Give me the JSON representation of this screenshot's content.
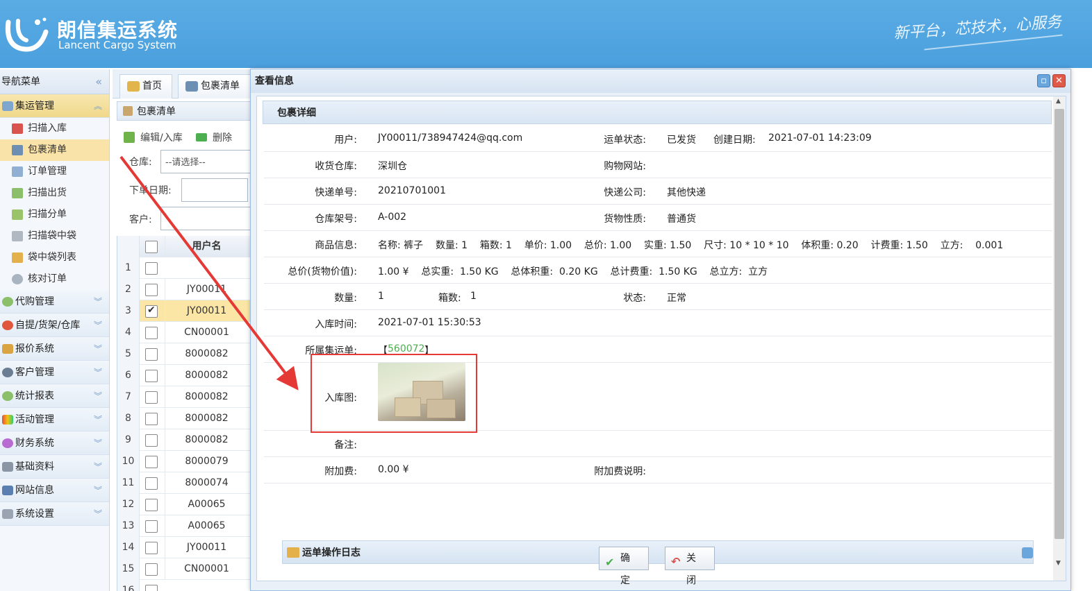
{
  "header": {
    "app_title": "朗信集运系统",
    "app_subtitle": "Lancent Cargo System",
    "slogan": "新平台，芯技术，心服务"
  },
  "sidebar": {
    "title": "导航菜单",
    "collapse_glyph": "«",
    "groups": [
      {
        "label": "集运管理",
        "open": true
      },
      {
        "label": "代购管理"
      },
      {
        "label": "自提/货架/仓库"
      },
      {
        "label": "报价系统"
      },
      {
        "label": "客户管理"
      },
      {
        "label": "统计报表"
      },
      {
        "label": "活动管理"
      },
      {
        "label": "财务系统"
      },
      {
        "label": "基础资料"
      },
      {
        "label": "网站信息"
      },
      {
        "label": "系统设置"
      }
    ],
    "items": [
      {
        "label": "扫描入库"
      },
      {
        "label": "包裹清单",
        "active": true
      },
      {
        "label": "订单管理"
      },
      {
        "label": "扫描出货"
      },
      {
        "label": "扫描分单"
      },
      {
        "label": "扫描袋中袋"
      },
      {
        "label": "袋中袋列表"
      },
      {
        "label": "核对订单"
      }
    ]
  },
  "tabs": [
    {
      "label": "首页"
    },
    {
      "label": "包裹清单"
    }
  ],
  "list_panel": {
    "title": "包裹清单",
    "toolbar": {
      "edit_label": "编辑/入库",
      "delete_label": "删除"
    },
    "filters": {
      "warehouse_label": "仓库:",
      "warehouse_value": "--请选择--",
      "order_date_label": "下单日期:",
      "customer_label": "客户:"
    },
    "grid": {
      "column_username": "用户名",
      "rows": [
        {
          "n": "1",
          "user": ""
        },
        {
          "n": "2",
          "user": "JY00011"
        },
        {
          "n": "3",
          "user": "JY00011",
          "selected": true
        },
        {
          "n": "4",
          "user": "CN00001"
        },
        {
          "n": "5",
          "user": "8000082"
        },
        {
          "n": "6",
          "user": "8000082"
        },
        {
          "n": "7",
          "user": "8000082"
        },
        {
          "n": "8",
          "user": "8000082"
        },
        {
          "n": "9",
          "user": "8000082"
        },
        {
          "n": "10",
          "user": "8000079"
        },
        {
          "n": "11",
          "user": "8000074"
        },
        {
          "n": "12",
          "user": "A00065"
        },
        {
          "n": "13",
          "user": "A00065"
        },
        {
          "n": "14",
          "user": "JY00011"
        },
        {
          "n": "15",
          "user": "CN00001"
        },
        {
          "n": "16",
          "user": ""
        }
      ]
    }
  },
  "dialog": {
    "title": "查看信息",
    "section_title": "包裹详细",
    "fields": {
      "user_label": "用户:",
      "user_value": "JY00011/738947424@qq.com",
      "status_label": "运单状态:",
      "status_value": "已发货",
      "created_label": "创建日期:",
      "created_value": "2021-07-01 14:23:09",
      "warehouse_label": "收货仓库:",
      "warehouse_value": "深圳仓",
      "site_label": "购物网站:",
      "tracking_label": "快递单号:",
      "tracking_value": "20210701001",
      "courier_label": "快递公司:",
      "courier_value": "其他快递",
      "shelf_label": "仓库架号:",
      "shelf_value": "A-002",
      "goods_type_label": "货物性质:",
      "goods_type_value": "普通货",
      "goods_info_label": "商品信息:",
      "goods_info_value": "名称: 裤子    数量: 1    箱数: 1    单价: 1.00    总价: 1.00    实重: 1.50    尺寸: 10 * 10 * 10    体积重: 0.20    计费重: 1.50    立方:    0.001",
      "total_label": "总价(货物价值):",
      "total_value": "1.00 ¥    总实重:  1.50 KG    总体积重:  0.20 KG    总计费重:  1.50 KG    总立方:  立方",
      "qty_label": "数量:",
      "qty_value": "1",
      "boxes_label": "箱数:",
      "boxes_value": "1",
      "state_label": "状态:",
      "state_value": "正常",
      "instock_time_label": "入库时间:",
      "instock_time_value": "2021-07-01 15:30:53",
      "consolidation_label": "所属集运单:",
      "consolidation_open": "【",
      "consolidation_value": "560072",
      "consolidation_close": "】",
      "instock_img_label": "入库图:",
      "remark_label": "备注:",
      "surcharge_label": "附加费:",
      "surcharge_value": "0.00 ¥",
      "surcharge_note_label": "附加费说明:"
    },
    "log_panel_title": "运单操作日志",
    "ok_button": "确定",
    "close_button": "关闭"
  },
  "colors": {
    "header_blue": "#4a9fdd",
    "annotation_red": "#e53935",
    "link_green": "#4caf50",
    "selected_row": "#fbe6a6"
  }
}
